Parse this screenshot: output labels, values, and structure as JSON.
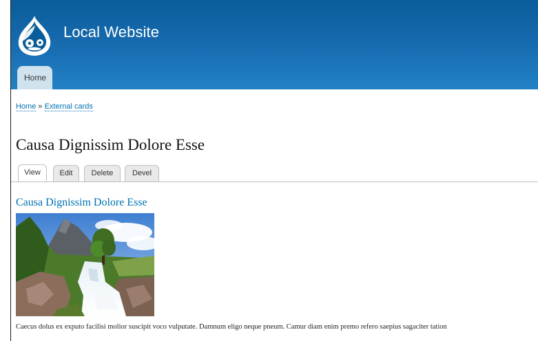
{
  "header": {
    "site_name": "Local Website",
    "logo_icon": "drupal-drop-logo-icon",
    "primary_tabs": [
      {
        "label": "Home",
        "active": true
      }
    ],
    "gradient_colors": [
      "#0a5d9a",
      "#2281c6"
    ]
  },
  "breadcrumb": {
    "items": [
      "Home",
      "External cards"
    ],
    "separator": "»"
  },
  "page": {
    "title": "Causa Dignissim Dolore Esse"
  },
  "tabs": [
    {
      "label": "View",
      "active": true
    },
    {
      "label": "Edit",
      "active": false
    },
    {
      "label": "Delete",
      "active": false
    },
    {
      "label": "Devel",
      "active": false
    }
  ],
  "node": {
    "title": "Causa Dignissim Dolore Esse",
    "image_icon": "landscape-waterfall-image",
    "body": "Caecus dolus ex exputo facilisi molior suscipit voco vulputate. Damnum eligo neque pneum. Camur diam enim premo refero saepius sagaciter tation"
  },
  "colors": {
    "link": "#0071b3",
    "tab_bg": "#cfe2ee"
  }
}
